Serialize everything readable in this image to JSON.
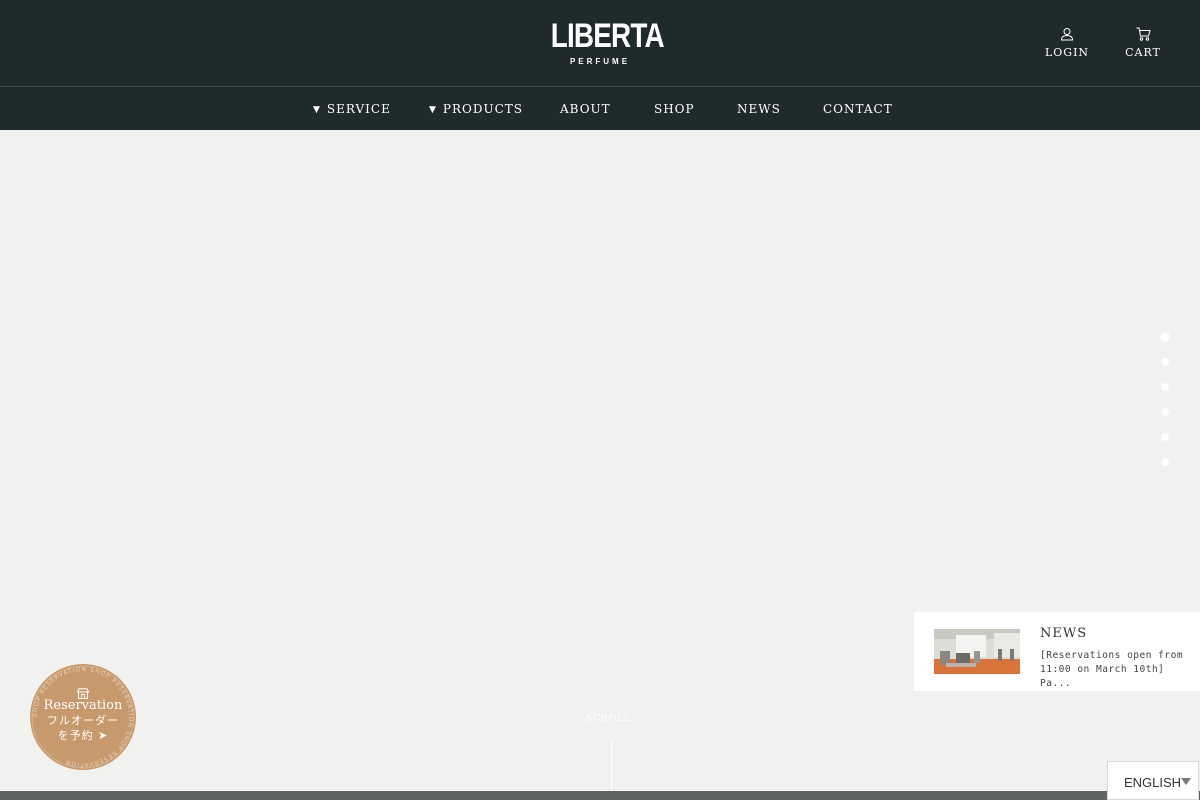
{
  "brand": {
    "name": "LIBERTA",
    "sub": "PERFUME"
  },
  "header": {
    "login_label": "LOGIN",
    "cart_label": "CART"
  },
  "nav": {
    "items": [
      {
        "label": "SERVICE",
        "has_dropdown": true
      },
      {
        "label": "PRODUCTS",
        "has_dropdown": true
      },
      {
        "label": "ABOUT",
        "has_dropdown": false
      },
      {
        "label": "SHOP",
        "has_dropdown": false
      },
      {
        "label": "NEWS",
        "has_dropdown": false
      },
      {
        "label": "CONTACT",
        "has_dropdown": false
      }
    ]
  },
  "slider": {
    "count": 6,
    "active_index": 0
  },
  "news": {
    "title": "NEWS",
    "text": "[Reservations open from 11:00 on March 10th] Pa..."
  },
  "reservation": {
    "label_en": "Reservation",
    "label_jp_1": "フルオーダー",
    "label_jp_2": "を予約 ➤",
    "ring_text": "SHOP RESERVATION SHOP RESERVATION SHOP RESERVATION"
  },
  "scroll": {
    "label": "SCROLL"
  },
  "language": {
    "selected": "ENGLISH"
  },
  "colors": {
    "header_bg": "#1f2a2c",
    "hero_bg": "#f1f2ef",
    "badge": "#c79a6e",
    "footer_bar": "#5f6464"
  }
}
